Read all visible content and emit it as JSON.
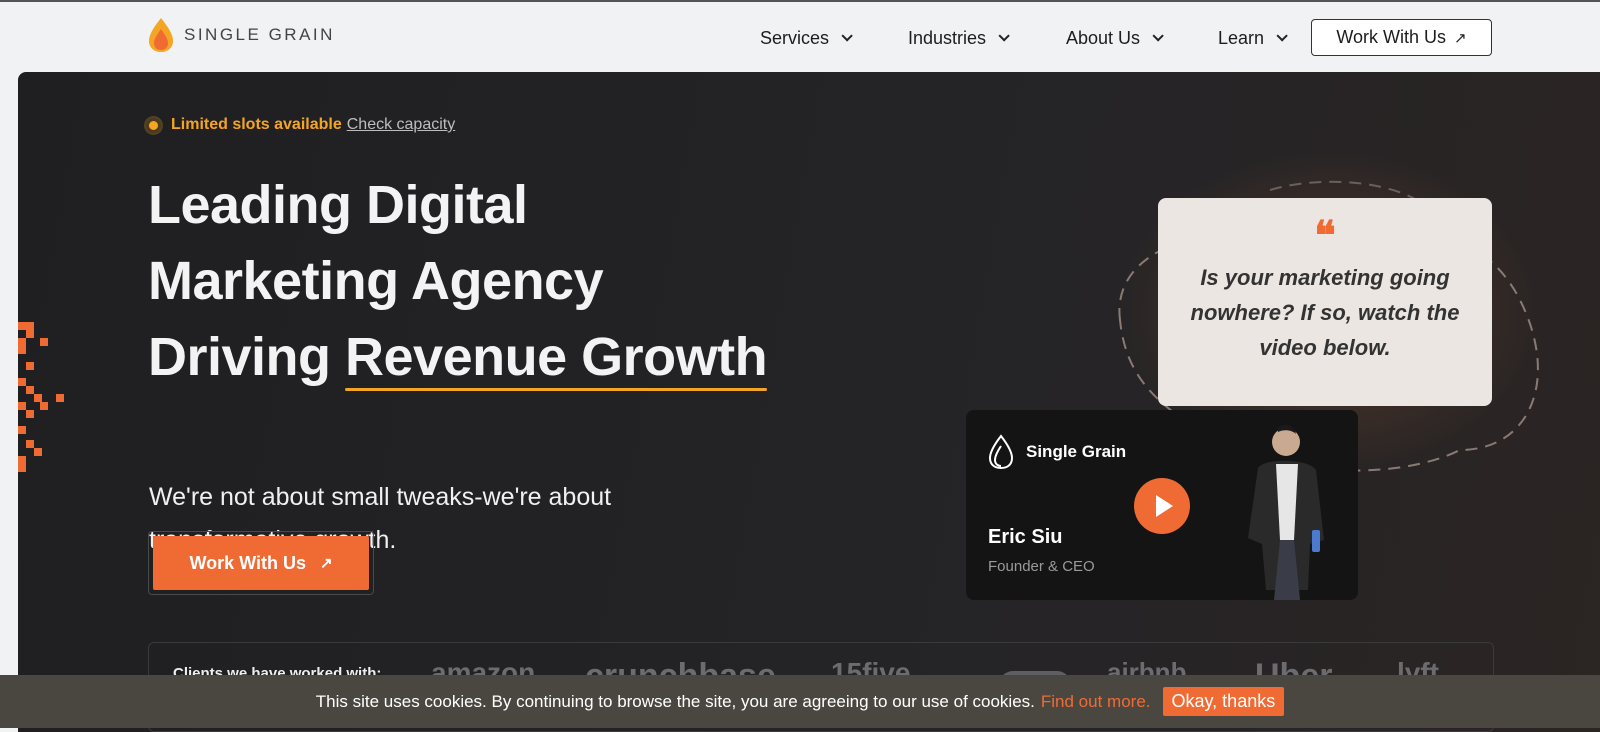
{
  "brand": {
    "name": "SINGLE GRAIN"
  },
  "nav": {
    "items": [
      {
        "label": "Services"
      },
      {
        "label": "Industries"
      },
      {
        "label": "About Us"
      },
      {
        "label": "Learn"
      }
    ],
    "cta_label": "Work With Us"
  },
  "hero": {
    "slots_text": "Limited slots available",
    "slots_link": "Check capacity",
    "headline_1": "Leading Digital",
    "headline_2": "Marketing Agency",
    "headline_3a": "Driving ",
    "headline_3b": "Revenue Growth",
    "subheadline": "We're not about small tweaks-we're about transformative growth.",
    "cta_label": "Work With Us"
  },
  "quote": {
    "mark": "❝",
    "text": "Is your marketing going nowhere? If so, watch the video below."
  },
  "video": {
    "brand": "Single Grain",
    "name": "Eric Siu",
    "role": "Founder & CEO"
  },
  "clients": {
    "label": "Clients we have worked with:",
    "logos": [
      "amazon",
      "crunchbase",
      "15five",
      "salesforce",
      "airbnb",
      "Uber",
      "lyft"
    ]
  },
  "cookie": {
    "text": "This site uses cookies. By continuing to browse the site, you are agreeing to our use of cookies.",
    "link": "Find out more.",
    "button": "Okay, thanks"
  },
  "colors": {
    "accent": "#f06b34",
    "highlight": "#f5a524",
    "dark_bg": "#232325"
  }
}
